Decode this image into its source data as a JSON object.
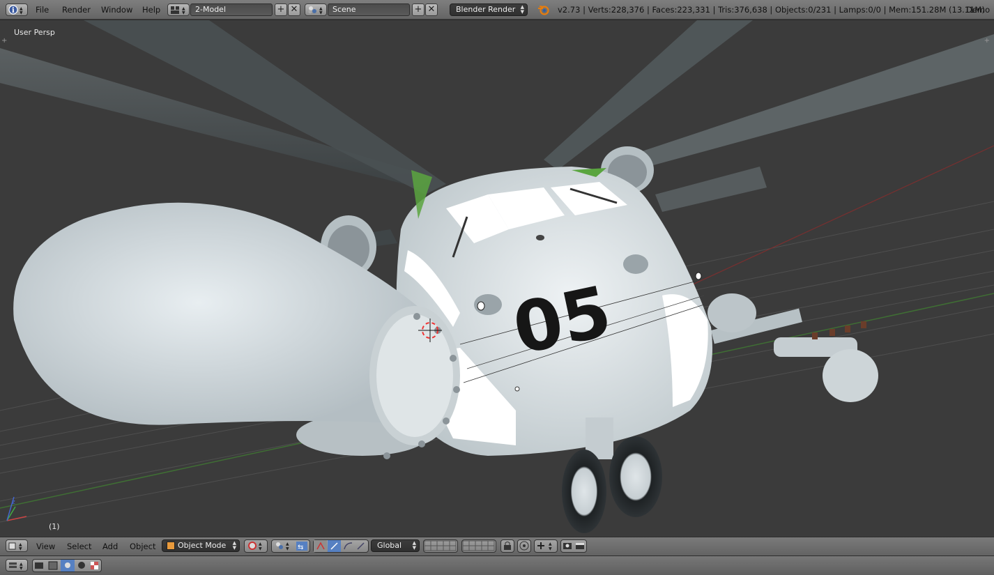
{
  "topbar": {
    "menu": [
      "File",
      "Render",
      "Window",
      "Help"
    ],
    "screen_layout": "2-Model",
    "scene": "Scene",
    "render_engine": "Blender Render",
    "stats": "v2.73 | Verts:228,376 | Faces:223,331 | Tris:376,638 | Objects:0/231 | Lamps:0/0 | Mem:151.28M (13.11M)",
    "right_label": "Demo"
  },
  "viewport": {
    "view_label": "User Persp",
    "frame_label": "(1)",
    "fuselage_number": "05"
  },
  "view3d_header": {
    "menu": [
      "View",
      "Select",
      "Add",
      "Object"
    ],
    "mode": "Object Mode",
    "orientation": "Global"
  },
  "colors": {
    "viewport_bg": "#3b3b3b",
    "header_bg": "#6e6e6e",
    "selected_blue": "#5680c2"
  }
}
